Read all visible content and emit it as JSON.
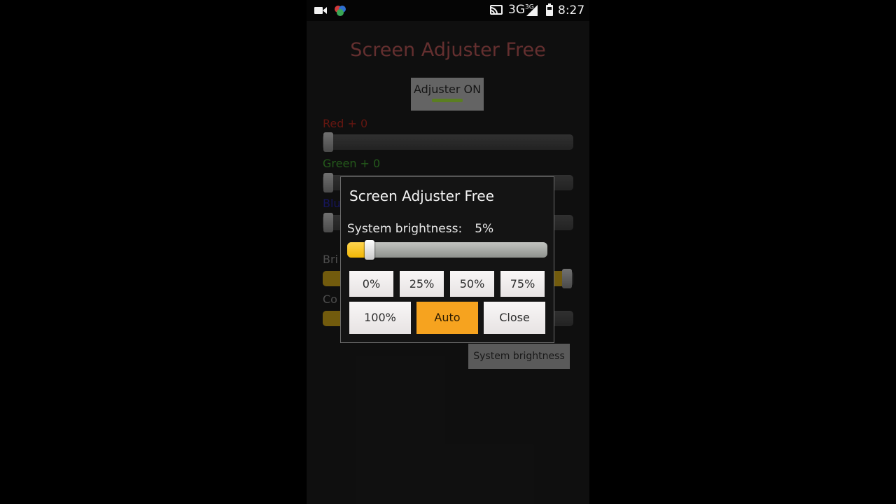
{
  "status_bar": {
    "network": "3G",
    "network_sup": "3G",
    "time": "8:27"
  },
  "app": {
    "title": "Screen Adjuster Free",
    "adjuster_button": "Adjuster ON",
    "sliders": {
      "red_label": "Red + 0",
      "green_label": "Green + 0",
      "blue_label": "Blu",
      "brightness_label": "Bri",
      "contrast_label": "Co"
    },
    "system_brightness_button": "System brightness"
  },
  "dialog": {
    "title": "Screen Adjuster Free",
    "brightness_label": "System brightness:",
    "brightness_value": "5%",
    "brightness_fraction": 0.05,
    "presets": [
      "0%",
      "25%",
      "50%",
      "75%"
    ],
    "btn_100": "100%",
    "btn_auto": "Auto",
    "btn_close": "Close"
  },
  "colors": {
    "accent_orange": "#f6a31f",
    "slider_yellow": "#f2b705"
  }
}
